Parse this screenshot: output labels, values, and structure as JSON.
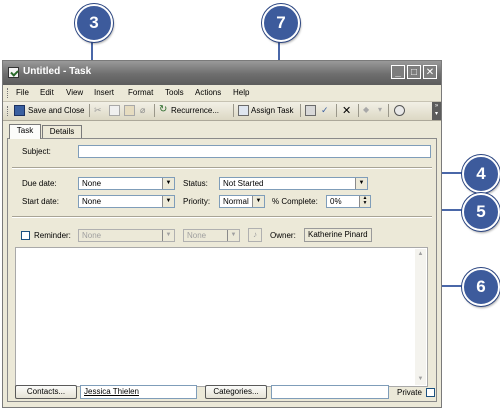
{
  "callouts": {
    "c3": "3",
    "c7": "7",
    "c4": "4",
    "c5": "5",
    "c6": "6"
  },
  "window": {
    "title": "Untitled - Task",
    "controls": {
      "minimize": "_",
      "maximize": "□",
      "close": "✕"
    }
  },
  "menu": {
    "items": [
      "File",
      "Edit",
      "View",
      "Insert",
      "Format",
      "Tools",
      "Actions",
      "Help"
    ]
  },
  "toolbar": {
    "save_close": "Save and Close",
    "recurrence": "Recurrence...",
    "assign_task": "Assign Task",
    "icons": [
      "save-icon",
      "cut-icon",
      "copy-icon",
      "paste-icon",
      "attach-icon",
      "recurrence-icon",
      "assign-task-icon",
      "print-icon",
      "check-icon",
      "delete-icon",
      "prev-icon",
      "next-icon",
      "help-icon"
    ]
  },
  "tabs": [
    "Task",
    "Details"
  ],
  "form": {
    "subject_label": "Subject:",
    "subject_value": "",
    "due_label": "Due date:",
    "due_value": "None",
    "start_label": "Start date:",
    "start_value": "None",
    "status_label": "Status:",
    "status_value": "Not Started",
    "priority_label": "Priority:",
    "priority_value": "Normal",
    "percent_label": "% Complete:",
    "percent_value": "0%",
    "reminder_label": "Reminder:",
    "reminder_date": "None",
    "reminder_time": "None",
    "owner_label": "Owner:",
    "owner_value": "Katherine Pinard"
  },
  "footer": {
    "contacts_button": "Contacts...",
    "contacts_value": "Jessica Thielen",
    "categories_button": "Categories...",
    "categories_value": "",
    "private_label": "Private"
  },
  "colors": {
    "callout": "#3d5b9c",
    "titlebar": "#6e6e6e",
    "chrome": "#ece9d8"
  }
}
